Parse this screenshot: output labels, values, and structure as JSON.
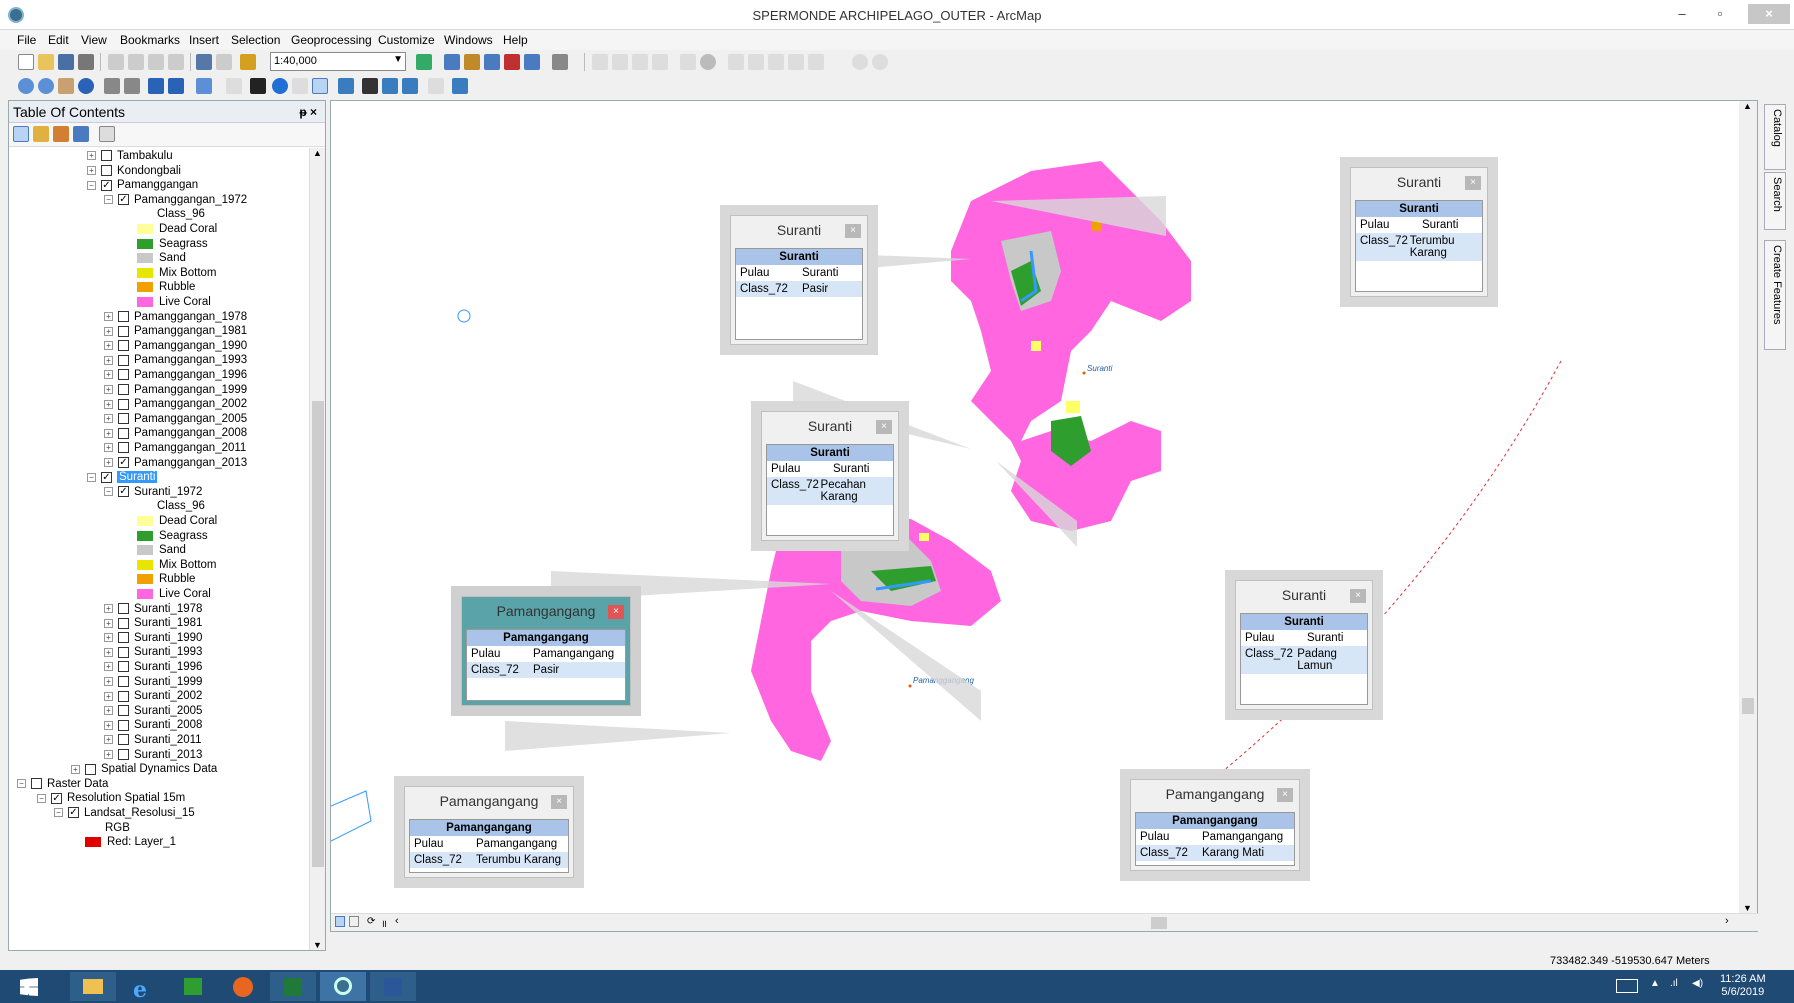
{
  "window": {
    "title": "SPERMONDE ARCHIPELAGO_OUTER - ArcMap",
    "minimize": "–",
    "restore": "▫",
    "close": "×"
  },
  "menu": [
    "File",
    "Edit",
    "View",
    "Bookmarks",
    "Insert",
    "Selection",
    "Geoprocessing",
    "Customize",
    "Windows",
    "Help"
  ],
  "toolbar": {
    "scale": "1:40,000"
  },
  "toc": {
    "title": "Table Of Contents",
    "pin": "ᵽ ×"
  },
  "tree": [
    {
      "label": "Tambakulu",
      "exp": "+",
      "chk": "",
      "indent": 100
    },
    {
      "label": "Kondongbali",
      "exp": "+",
      "chk": "",
      "indent": 100
    },
    {
      "label": "Pamanggangan",
      "exp": "−",
      "chk": "✓",
      "indent": 100
    },
    {
      "label": "Pamanggangan_1972",
      "exp": "−",
      "chk": "✓",
      "indent": 117
    },
    {
      "label": "Class_96",
      "indent": 170
    },
    {
      "label": "Dead Coral",
      "swatch": "#ffff99",
      "indent": 150
    },
    {
      "label": "Seagrass",
      "swatch": "#2e9e2e",
      "indent": 150
    },
    {
      "label": "Sand",
      "swatch": "#c8c8c8",
      "indent": 150
    },
    {
      "label": "Mix Bottom",
      "swatch": "#e6e600",
      "indent": 150
    },
    {
      "label": "Rubble",
      "swatch": "#f0a000",
      "indent": 150
    },
    {
      "label": "Live Coral",
      "swatch": "#ff66e0",
      "indent": 150
    },
    {
      "label": "Pamanggangan_1978",
      "exp": "+",
      "chk": "",
      "indent": 117
    },
    {
      "label": "Pamanggangan_1981",
      "exp": "+",
      "chk": "",
      "indent": 117
    },
    {
      "label": "Pamanggangan_1990",
      "exp": "+",
      "chk": "",
      "indent": 117
    },
    {
      "label": "Pamanggangan_1993",
      "exp": "+",
      "chk": "",
      "indent": 117
    },
    {
      "label": "Pamanggangan_1996",
      "exp": "+",
      "chk": "",
      "indent": 117
    },
    {
      "label": "Pamanggangan_1999",
      "exp": "+",
      "chk": "",
      "indent": 117
    },
    {
      "label": "Pamanggangan_2002",
      "exp": "+",
      "chk": "",
      "indent": 117
    },
    {
      "label": "Pamanggangan_2005",
      "exp": "+",
      "chk": "",
      "indent": 117
    },
    {
      "label": "Pamanggangan_2008",
      "exp": "+",
      "chk": "",
      "indent": 117
    },
    {
      "label": "Pamanggangan_2011",
      "exp": "+",
      "chk": "",
      "indent": 117
    },
    {
      "label": "Pamanggangan_2013",
      "exp": "+",
      "chk": "✓",
      "indent": 117
    },
    {
      "label": "Suranti",
      "exp": "−",
      "chk": "✓",
      "indent": 100,
      "selected": true
    },
    {
      "label": "Suranti_1972",
      "exp": "−",
      "chk": "✓",
      "indent": 117
    },
    {
      "label": "Class_96",
      "indent": 170
    },
    {
      "label": "Dead Coral",
      "swatch": "#ffff99",
      "indent": 150
    },
    {
      "label": "Seagrass",
      "swatch": "#2e9e2e",
      "indent": 150
    },
    {
      "label": "Sand",
      "swatch": "#c8c8c8",
      "indent": 150
    },
    {
      "label": "Mix Bottom",
      "swatch": "#e6e600",
      "indent": 150
    },
    {
      "label": "Rubble",
      "swatch": "#f0a000",
      "indent": 150
    },
    {
      "label": "Live Coral",
      "swatch": "#ff66e0",
      "indent": 150
    },
    {
      "label": "Suranti_1978",
      "exp": "+",
      "chk": "",
      "indent": 117
    },
    {
      "label": "Suranti_1981",
      "exp": "+",
      "chk": "",
      "indent": 117
    },
    {
      "label": "Suranti_1990",
      "exp": "+",
      "chk": "",
      "indent": 117
    },
    {
      "label": "Suranti_1993",
      "exp": "+",
      "chk": "",
      "indent": 117
    },
    {
      "label": "Suranti_1996",
      "exp": "+",
      "chk": "",
      "indent": 117
    },
    {
      "label": "Suranti_1999",
      "exp": "+",
      "chk": "",
      "indent": 117
    },
    {
      "label": "Suranti_2002",
      "exp": "+",
      "chk": "",
      "indent": 117
    },
    {
      "label": "Suranti_2005",
      "exp": "+",
      "chk": "",
      "indent": 117
    },
    {
      "label": "Suranti_2008",
      "exp": "+",
      "chk": "",
      "indent": 117
    },
    {
      "label": "Suranti_2011",
      "exp": "+",
      "chk": "",
      "indent": 117
    },
    {
      "label": "Suranti_2013",
      "exp": "+",
      "chk": "",
      "indent": 117
    },
    {
      "label": "Spatial Dynamics Data",
      "exp": "+",
      "chk": "",
      "indent": 84
    },
    {
      "label": "Raster Data",
      "exp": "−",
      "chk": "",
      "indent": 30
    },
    {
      "label": "Resolution Spatial 15m",
      "exp": "−",
      "chk": "✓",
      "indent": 50
    },
    {
      "label": "Landsat_Resolusi_15",
      "exp": "−",
      "chk": "✓",
      "indent": 67
    },
    {
      "label": "RGB",
      "indent": 118
    },
    {
      "label": "Red:   Layer_1",
      "swatch": "#e00000",
      "indent": 98
    }
  ],
  "map": {
    "label_suranti": "Suranti",
    "label_pamanggangang": "Pamanggangang"
  },
  "popups": [
    {
      "title": "Suranti",
      "header": "Suranti",
      "rows": [
        [
          "Pulau",
          "Suranti"
        ],
        [
          "Class_72",
          "Pasir"
        ]
      ]
    },
    {
      "title": "Suranti",
      "header": "Suranti",
      "rows": [
        [
          "Pulau",
          "Suranti"
        ],
        [
          "Class_72",
          "Terumbu Karang"
        ]
      ]
    },
    {
      "title": "Suranti",
      "header": "Suranti",
      "rows": [
        [
          "Pulau",
          "Suranti"
        ],
        [
          "Class_72",
          "Pecahan Karang"
        ]
      ]
    },
    {
      "title": "Suranti",
      "header": "Suranti",
      "rows": [
        [
          "Pulau",
          "Suranti"
        ],
        [
          "Class_72",
          "Padang Lamun"
        ]
      ]
    },
    {
      "title": "Pamangangang",
      "header": "Pamangangang",
      "rows": [
        [
          "Pulau",
          "Pamangangang"
        ],
        [
          "Class_72",
          "Pasir"
        ]
      ]
    },
    {
      "title": "Pamangangang",
      "header": "Pamangangang",
      "rows": [
        [
          "Pulau",
          "Pamangangang"
        ],
        [
          "Class_72",
          "Terumbu Karang"
        ]
      ]
    },
    {
      "title": "Pamangangang",
      "header": "Pamangangang",
      "rows": [
        [
          "Pulau",
          "Pamangangang"
        ],
        [
          "Class_72",
          "Karang Mati"
        ]
      ]
    }
  ],
  "dock": {
    "catalog": "Catalog",
    "search": "Search",
    "create": "Create Features"
  },
  "status": {
    "coords": "733482.349  -519530.647 Meters"
  },
  "clock": {
    "time": "11:26 AM",
    "date": "5/6/2019"
  }
}
